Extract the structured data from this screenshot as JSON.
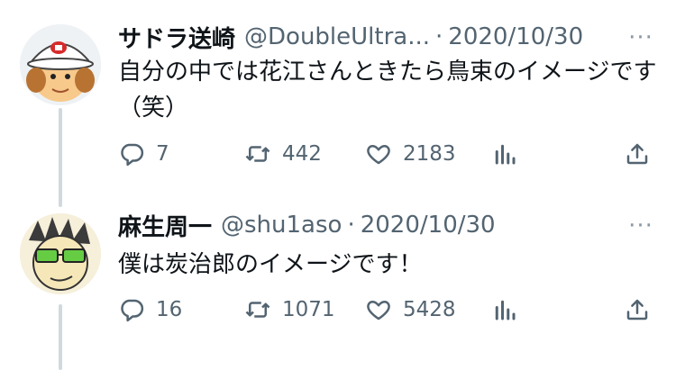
{
  "tweets": [
    {
      "display_name": "サドラ送崎",
      "handle": "@DoubleUltra...",
      "separator": "·",
      "date": "2020/10/30",
      "more": "···",
      "text": "自分の中では花江さんときたら鳥束のイメージです（笑）",
      "replies": "7",
      "retweets": "442",
      "likes": "2183"
    },
    {
      "display_name": "麻生周一",
      "handle": "@shu1aso",
      "separator": "·",
      "date": "2020/10/30",
      "more": "···",
      "text": "僕は炭治郎のイメージです！",
      "replies": "16",
      "retweets": "1071",
      "likes": "5428"
    }
  ],
  "icons": {
    "reply": "reply-icon",
    "retweet": "retweet-icon",
    "like": "heart-icon",
    "views": "views-chart-icon",
    "share": "share-icon",
    "more": "more-icon"
  },
  "colors": {
    "text": "#0f1419",
    "secondary": "#536471",
    "thread_line": "#cfd9de"
  }
}
